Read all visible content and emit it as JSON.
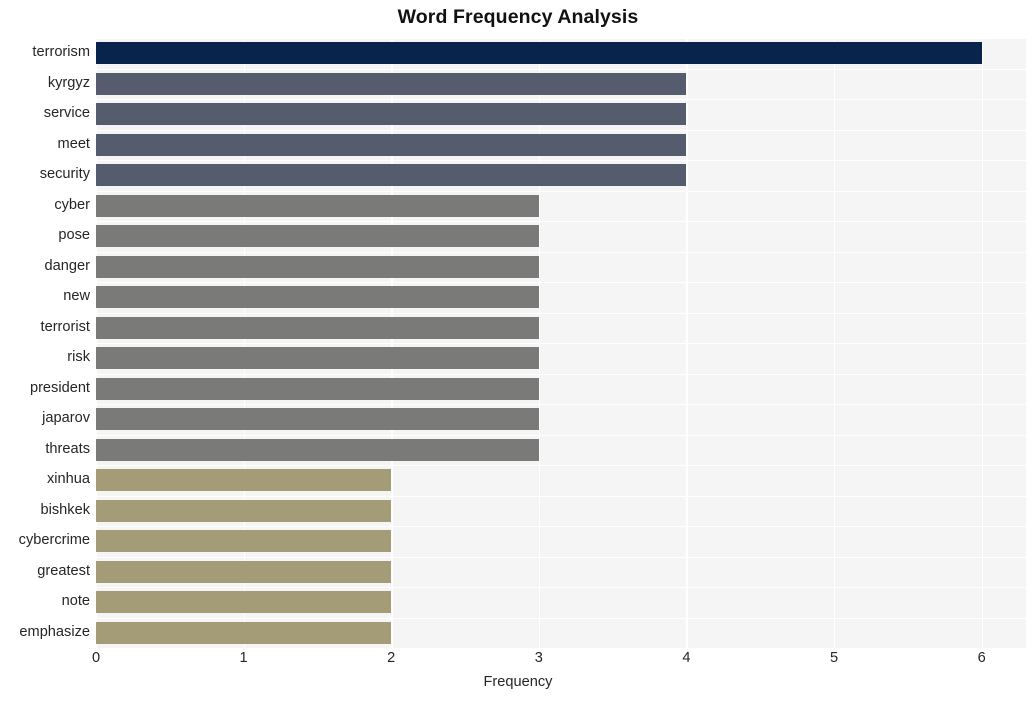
{
  "chart_data": {
    "type": "bar",
    "orientation": "horizontal",
    "title": "Word Frequency Analysis",
    "xlabel": "Frequency",
    "ylabel": "",
    "xlim": [
      0,
      6.3
    ],
    "xticks": [
      "0",
      "1",
      "2",
      "3",
      "4",
      "5",
      "6"
    ],
    "xtick_values": [
      0,
      1,
      2,
      3,
      4,
      5,
      6
    ],
    "grid": true,
    "legend": null,
    "categories": [
      "terrorism",
      "kyrgyz",
      "service",
      "meet",
      "security",
      "cyber",
      "pose",
      "danger",
      "new",
      "terrorist",
      "risk",
      "president",
      "japarov",
      "threats",
      "xinhua",
      "bishkek",
      "cybercrime",
      "greatest",
      "note",
      "emphasize"
    ],
    "values": [
      6,
      4,
      4,
      4,
      4,
      3,
      3,
      3,
      3,
      3,
      3,
      3,
      3,
      3,
      2,
      2,
      2,
      2,
      2,
      2
    ],
    "bar_colors": [
      "#08244c",
      "#555c6e",
      "#555c6e",
      "#555c6e",
      "#555c6e",
      "#7a7a78",
      "#7a7a78",
      "#7a7a78",
      "#7a7a78",
      "#7a7a78",
      "#7a7a78",
      "#7a7a78",
      "#7a7a78",
      "#7a7a78",
      "#a39c76",
      "#a39c76",
      "#a39c76",
      "#a39c76",
      "#a39c76",
      "#a39c76"
    ],
    "plot_background": "#f5f5f6",
    "gridline_color": "#ffffff",
    "text_color": "#262626"
  }
}
